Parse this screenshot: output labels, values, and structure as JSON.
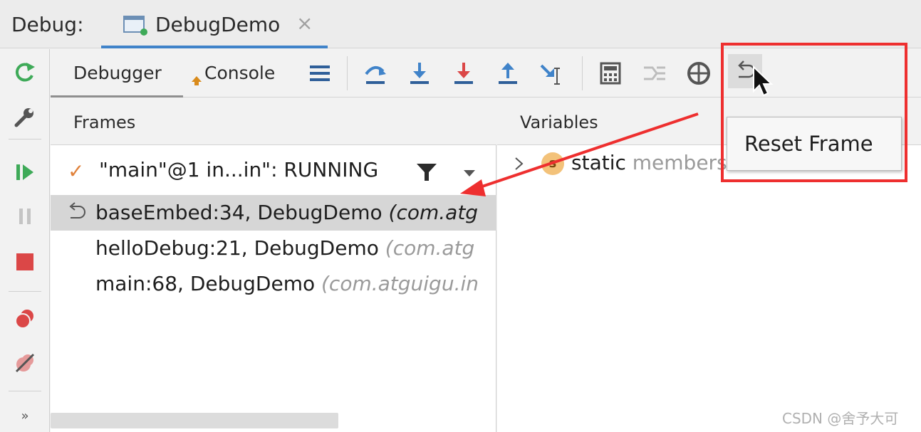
{
  "window": {
    "debug_label": "Debug:",
    "tab_label": "DebugDemo",
    "tab_close": "×"
  },
  "toolbar": {
    "tabs": [
      {
        "label": "Debugger",
        "active": true
      },
      {
        "label": "Console",
        "active": false
      }
    ]
  },
  "frames": {
    "header": "Frames",
    "thread": {
      "label": "\"main\"@1 in...in\": RUNNING"
    },
    "rows": [
      {
        "name": "baseEmbed:34, DebugDemo ",
        "pkg": "(com.atg",
        "selected": true
      },
      {
        "name": "helloDebug:21, DebugDemo ",
        "pkg": "(com.atg",
        "selected": false
      },
      {
        "name": "main:68, DebugDemo ",
        "pkg": "(com.atguigu.in",
        "selected": false
      }
    ]
  },
  "variables": {
    "header": "Variables",
    "row": {
      "badge": "s",
      "name": "static ",
      "kind": "members"
    }
  },
  "popup": {
    "label": "Reset Frame"
  },
  "watermark": "CSDN @舍予大可",
  "colors": {
    "highlight": "#ee2f2f",
    "accent": "#4083c9",
    "green": "#3eaa58",
    "red": "#db4747"
  }
}
